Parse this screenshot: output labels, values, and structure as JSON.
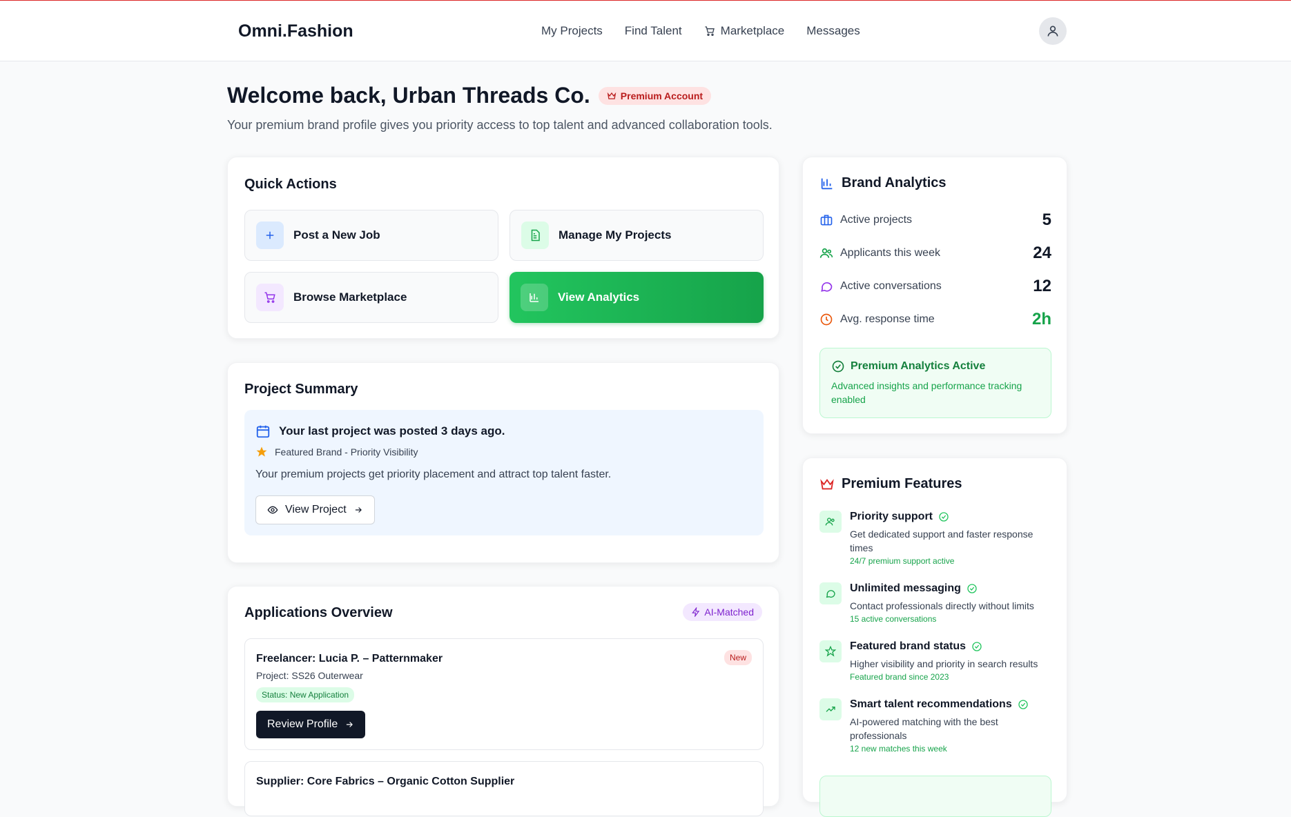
{
  "nav": {
    "brand": "Omni.Fashion",
    "links": [
      "My Projects",
      "Find Talent",
      "Marketplace",
      "Messages"
    ]
  },
  "welcome": {
    "title": "Welcome back, Urban Threads Co.",
    "badge": "Premium Account",
    "subtitle": "Your premium brand profile gives you priority access to top talent and advanced collaboration tools."
  },
  "quick_actions": {
    "title": "Quick Actions",
    "items": [
      "Post a New Job",
      "Manage My Projects",
      "Browse Marketplace",
      "View Analytics"
    ]
  },
  "project_summary": {
    "title": "Project Summary",
    "headline": "Your last project was posted 3 days ago.",
    "featured": "Featured Brand - Priority Visibility",
    "description": "Your premium projects get priority placement and attract top talent faster.",
    "button": "View Project"
  },
  "applications": {
    "title": "Applications Overview",
    "badge": "AI-Matched",
    "items": [
      {
        "name": "Freelancer: Lucia P. – Patternmaker",
        "project": "Project: SS26 Outerwear",
        "status": "Status: New Application",
        "badge": "New",
        "button": "Review Profile"
      },
      {
        "name": "Supplier: Core Fabrics – Organic Cotton Supplier"
      }
    ]
  },
  "analytics": {
    "title": "Brand Analytics",
    "stats": [
      {
        "label": "Active projects",
        "value": "5"
      },
      {
        "label": "Applicants this week",
        "value": "24"
      },
      {
        "label": "Active conversations",
        "value": "12"
      },
      {
        "label": "Avg. response time",
        "value": "2h"
      }
    ],
    "premium_title": "Premium Analytics Active",
    "premium_desc": "Advanced insights and performance tracking enabled"
  },
  "premium_features": {
    "title": "Premium Features",
    "items": [
      {
        "name": "Priority support",
        "desc": "Get dedicated support and faster response times",
        "note": "24/7 premium support active"
      },
      {
        "name": "Unlimited messaging",
        "desc": "Contact professionals directly without limits",
        "note": "15 active conversations"
      },
      {
        "name": "Featured brand status",
        "desc": "Higher visibility and priority in search results",
        "note": "Featured brand since 2023"
      },
      {
        "name": "Smart talent recommendations",
        "desc": "AI-powered matching with the best professionals",
        "note": "12 new matches this week"
      }
    ]
  },
  "colors": {
    "accent_green": "#16a34a",
    "accent_red": "#dc2626",
    "accent_blue": "#2563eb",
    "accent_purple": "#9333ea",
    "accent_orange": "#ea580c"
  }
}
